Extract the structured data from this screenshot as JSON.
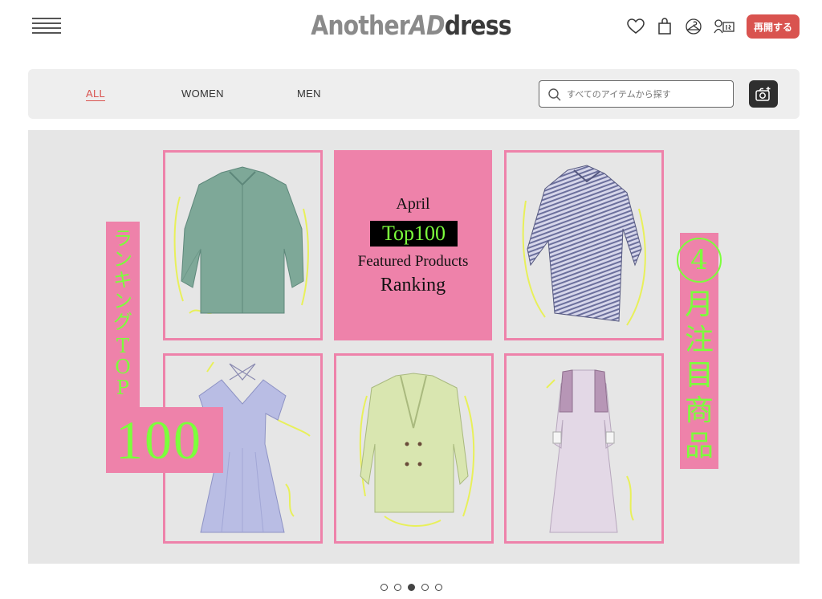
{
  "header": {
    "logo_part1": "Another",
    "logo_part2": "AD",
    "logo_part3": "dress",
    "resume_label": "再開する",
    "icons": [
      "menu-icon",
      "heart-icon",
      "bag-icon",
      "hanger-icon",
      "member-card-icon"
    ]
  },
  "nav": {
    "tabs": [
      {
        "label": "ALL",
        "active": true
      },
      {
        "label": "WOMEN",
        "active": false
      },
      {
        "label": "MEN",
        "active": false
      }
    ],
    "search_placeholder": "すべてのアイテムから探す",
    "camera_icon": "camera-search-icon"
  },
  "banner": {
    "center": {
      "month": "April",
      "top": "Top100",
      "line1": "Featured Products",
      "line2": "Ranking"
    },
    "left_vertical": [
      "ラ",
      "ン",
      "キ",
      "ン",
      "グ",
      "T",
      "O",
      "P"
    ],
    "left_number": "100",
    "right_number": "4",
    "right_vertical": [
      "月",
      "注",
      "目",
      "商",
      "品"
    ],
    "accent_pink": "#ee82aa",
    "accent_green": "#7cff3c"
  },
  "carousel": {
    "count": 5,
    "active_index": 2
  }
}
